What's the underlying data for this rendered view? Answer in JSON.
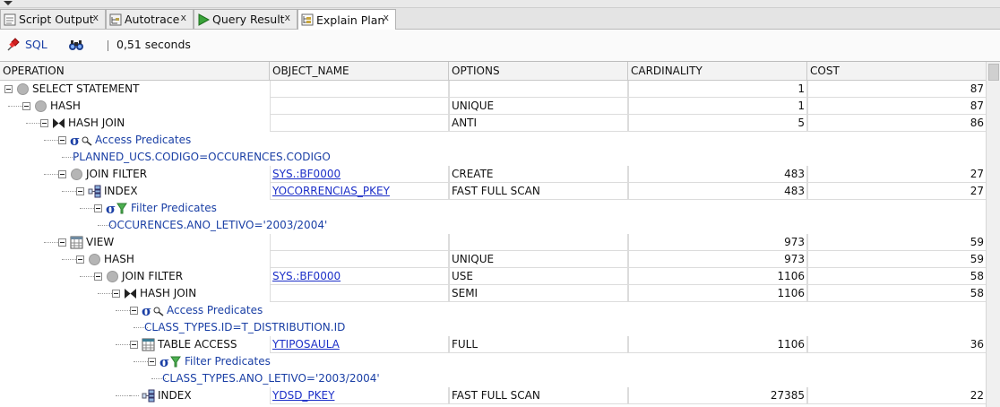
{
  "tabs": [
    {
      "label": "Script Output",
      "close": "x",
      "icon": "script-output-icon"
    },
    {
      "label": "Autotrace",
      "close": "x",
      "icon": "autotrace-icon"
    },
    {
      "label": "Query Result",
      "close": "x",
      "icon": "play-icon"
    },
    {
      "label": "Explain Plan",
      "close": "x",
      "icon": "explain-plan-icon",
      "active": true
    }
  ],
  "toolbar": {
    "sql_label": "SQL",
    "elapsed": "0,51 seconds"
  },
  "columns": [
    "OPERATION",
    "OBJECT_NAME",
    "OPTIONS",
    "CARDINALITY",
    "COST"
  ],
  "rows": [
    {
      "depth": 0,
      "kind": "op",
      "icon": "circle-icon",
      "op": "SELECT STATEMENT",
      "object": "",
      "options": "",
      "card": "1",
      "cost": "87"
    },
    {
      "depth": 1,
      "kind": "op",
      "icon": "circle-icon",
      "op": "HASH",
      "object": "",
      "options": "UNIQUE",
      "card": "1",
      "cost": "87"
    },
    {
      "depth": 2,
      "kind": "op",
      "icon": "hash-join-icon",
      "op": "HASH JOIN",
      "object": "",
      "options": "ANTI",
      "card": "5",
      "cost": "86"
    },
    {
      "depth": 3,
      "kind": "pred",
      "icon": "access-predicate-icon",
      "op": "Access Predicates"
    },
    {
      "depth": 4,
      "kind": "predtext",
      "op": "PLANNED_UCS.CODIGO=OCCURENCES.CODIGO"
    },
    {
      "depth": 3,
      "kind": "op",
      "icon": "circle-icon",
      "op": "JOIN FILTER",
      "object": "SYS.:BF0000",
      "options": "CREATE",
      "card": "483",
      "cost": "27"
    },
    {
      "depth": 4,
      "kind": "op",
      "icon": "index-icon",
      "op": "INDEX",
      "object": "YOCORRENCIAS_PKEY",
      "options": "FAST FULL SCAN",
      "card": "483",
      "cost": "27"
    },
    {
      "depth": 5,
      "kind": "pred",
      "icon": "filter-predicate-icon",
      "op": "Filter Predicates"
    },
    {
      "depth": 6,
      "kind": "predtext",
      "op": "OCCURENCES.ANO_LETIVO='2003/2004'"
    },
    {
      "depth": 3,
      "kind": "op",
      "icon": "view-icon",
      "op": "VIEW",
      "object": "",
      "options": "",
      "card": "973",
      "cost": "59"
    },
    {
      "depth": 4,
      "kind": "op",
      "icon": "circle-icon",
      "op": "HASH",
      "object": "",
      "options": "UNIQUE",
      "card": "973",
      "cost": "59"
    },
    {
      "depth": 5,
      "kind": "op",
      "icon": "circle-icon",
      "op": "JOIN FILTER",
      "object": "SYS.:BF0000",
      "options": "USE",
      "card": "1106",
      "cost": "58"
    },
    {
      "depth": 6,
      "kind": "op",
      "icon": "hash-join-icon",
      "op": "HASH JOIN",
      "object": "",
      "options": "SEMI",
      "card": "1106",
      "cost": "58"
    },
    {
      "depth": 7,
      "kind": "pred",
      "icon": "access-predicate-icon",
      "op": "Access Predicates"
    },
    {
      "depth": 8,
      "kind": "predtext",
      "op": "CLASS_TYPES.ID=T_DISTRIBUTION.ID"
    },
    {
      "depth": 7,
      "kind": "op",
      "icon": "table-icon",
      "op": "TABLE ACCESS",
      "object": "YTIPOSAULA",
      "options": "FULL",
      "card": "1106",
      "cost": "36"
    },
    {
      "depth": 8,
      "kind": "pred",
      "icon": "filter-predicate-icon",
      "op": "Filter Predicates"
    },
    {
      "depth": 9,
      "kind": "predtext",
      "op": "CLASS_TYPES.ANO_LETIVO='2003/2004'"
    },
    {
      "depth": 7,
      "kind": "leaf",
      "icon": "index-icon",
      "op": "INDEX",
      "object": "YDSD_PKEY",
      "options": "FAST FULL SCAN",
      "card": "27385",
      "cost": "22"
    }
  ]
}
